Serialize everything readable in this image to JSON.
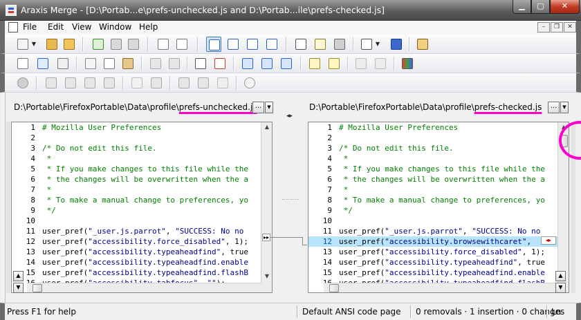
{
  "window": {
    "title": "Araxis Merge - [D:\\Portab...e\\prefs-unchecked.js and D:\\Portab...ile\\prefs-checked.js]",
    "min_label": "▁",
    "max_label": "▢",
    "close_label": "✕"
  },
  "menu": {
    "items": [
      "File",
      "Edit",
      "View",
      "Window",
      "Help"
    ],
    "mdi_min": "–",
    "mdi_restore": "❐",
    "mdi_close": "✕"
  },
  "left": {
    "path_prefix": "D:\\Portable\\FirefoxPortable\\Data\\profile\\",
    "path_file": "prefs-unchecked.js",
    "browse_label": "...",
    "drop_label": "▼",
    "lines": [
      {
        "n": "1",
        "t": "# Mozilla User Preferences",
        "c": "cmt"
      },
      {
        "n": "2",
        "t": "",
        "c": ""
      },
      {
        "n": "3",
        "t": "/* Do not edit this file.",
        "c": "cmt"
      },
      {
        "n": "4",
        "t": " *",
        "c": "cmt"
      },
      {
        "n": "5",
        "t": " * If you make changes to this file while the",
        "c": "cmt"
      },
      {
        "n": "6",
        "t": " * the changes will be overwritten when the a",
        "c": "cmt"
      },
      {
        "n": "7",
        "t": " *",
        "c": "cmt"
      },
      {
        "n": "8",
        "t": " * To make a manual change to preferences, yo",
        "c": "cmt"
      },
      {
        "n": "9",
        "t": " */",
        "c": "cmt"
      },
      {
        "n": "10",
        "t": "",
        "c": ""
      },
      {
        "n": "11",
        "t": "user_pref(\"_user.js.parrot\", \"SUCCESS: No no",
        "c": "code"
      },
      {
        "n": "12",
        "t": "user_pref(\"accessibility.force_disabled\", 1);",
        "c": "code"
      },
      {
        "n": "13",
        "t": "user_pref(\"accessibility.typeaheadfind\", true",
        "c": "code"
      },
      {
        "n": "14",
        "t": "user_pref(\"accessibility.typeaheadfind.enable",
        "c": "code"
      },
      {
        "n": "15",
        "t": "user_pref(\"accessibility.typeaheadfind.flashB",
        "c": "code"
      },
      {
        "n": "16",
        "t": "user_pref(\"accessibility.tabfocus\", \"\");",
        "c": "code"
      }
    ]
  },
  "right": {
    "path_prefix": "D:\\Portable\\FirefoxPortable\\Data\\profile\\",
    "path_file": "prefs-checked.js",
    "browse_label": "...",
    "drop_label": "▼",
    "lines": [
      {
        "n": "1",
        "t": "# Mozilla User Preferences",
        "c": "cmt"
      },
      {
        "n": "2",
        "t": "",
        "c": ""
      },
      {
        "n": "3",
        "t": "/* Do not edit this file.",
        "c": "cmt"
      },
      {
        "n": "4",
        "t": " *",
        "c": "cmt"
      },
      {
        "n": "5",
        "t": " * If you make changes to this file while the",
        "c": "cmt"
      },
      {
        "n": "6",
        "t": " * the changes will be overwritten when the a",
        "c": "cmt"
      },
      {
        "n": "7",
        "t": " *",
        "c": "cmt"
      },
      {
        "n": "8",
        "t": " * To make a manual change to preferences, yo",
        "c": "cmt"
      },
      {
        "n": "9",
        "t": " */",
        "c": "cmt"
      },
      {
        "n": "10",
        "t": "",
        "c": ""
      },
      {
        "n": "11",
        "t": "user_pref(\"_user.js.parrot\", \"SUCCESS: No no",
        "c": "code"
      },
      {
        "n": "12",
        "t": "user_pref(\"accessibility.browsewithcaret\",",
        "c": "code"
      },
      {
        "n": "13",
        "t": "user_pref(\"accessibility.force_disabled\", 1);",
        "c": "code"
      },
      {
        "n": "14",
        "t": "user_pref(\"accessibility.typeaheadfind\", true",
        "c": "code"
      },
      {
        "n": "15",
        "t": "user_pref(\"accessibility.typeaheadfind.enable",
        "c": "code"
      },
      {
        "n": "16",
        "t": "user_pref(\"accessibility.typeaheadfind.flashB",
        "c": "code"
      }
    ]
  },
  "status": {
    "help": "Press F1 for help",
    "encoding": "Default ANSI code page",
    "changes": "0 removals · 1 insertion · 0 changes",
    "position": "Ln"
  },
  "colors": {
    "comment": "#008000",
    "string": "#00008b",
    "insert_highlight": "#b8e4fb",
    "annotation": "#ff00cc"
  }
}
